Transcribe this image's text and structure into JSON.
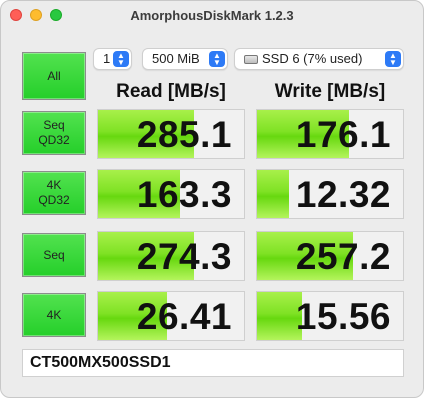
{
  "window": {
    "title": "AmorphousDiskMark 1.2.3"
  },
  "controls": {
    "count": "1",
    "size": "500 MiB",
    "drive": "SSD 6 (7% used)",
    "all_label": "All"
  },
  "headers": {
    "read": "Read [MB/s]",
    "write": "Write [MB/s]"
  },
  "tests": [
    {
      "label": "Seq\nQD32",
      "read": "285.1",
      "write": "176.1",
      "read_fill": 0.66,
      "write_fill": 0.63
    },
    {
      "label": "4K\nQD32",
      "read": "163.3",
      "write": "12.32",
      "read_fill": 0.56,
      "write_fill": 0.22
    },
    {
      "label": "Seq",
      "read": "274.3",
      "write": "257.2",
      "read_fill": 0.66,
      "write_fill": 0.66
    },
    {
      "label": "4K",
      "read": "26.41",
      "write": "15.56",
      "read_fill": 0.47,
      "write_fill": 0.31
    }
  ],
  "device_name": "CT500MX500SSD1",
  "colors": {
    "bar_green": "#7fe224",
    "button_green": "#35d93a",
    "select_accent": "#2d7af6"
  }
}
